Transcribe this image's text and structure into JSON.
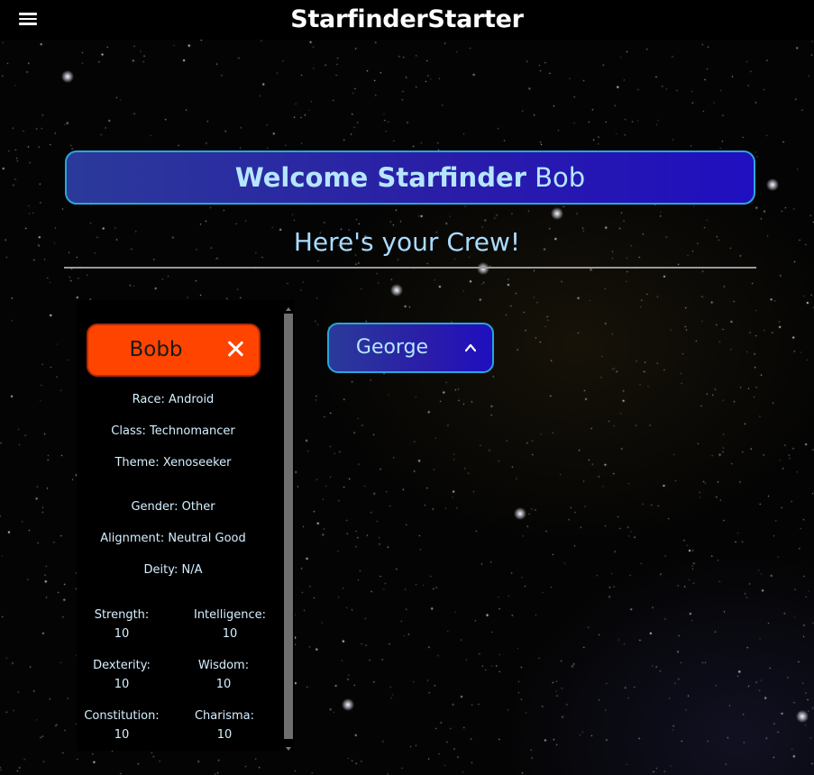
{
  "header": {
    "app_title": "StarfinderStarter",
    "menu_icon": "hamburger-menu-icon"
  },
  "welcome": {
    "prefix": "Welcome Starfinder",
    "user_name": "Bob"
  },
  "crew_heading": "Here's your Crew!",
  "crew": [
    {
      "name": "Bobb",
      "expanded": true,
      "color": "#ff4400",
      "close_icon": "close-icon",
      "details": {
        "race": "Race: Android",
        "class": "Class: Technomancer",
        "theme": "Theme: Xenoseeker",
        "gender": "Gender: Other",
        "alignment": "Alignment: Neutral Good",
        "deity": "Deity: N/A"
      },
      "stats": {
        "strength_label": "Strength:",
        "strength_value": "10",
        "intelligence_label": "Intelligence:",
        "intelligence_value": "10",
        "dexterity_label": "Dexterity:",
        "dexterity_value": "10",
        "wisdom_label": "Wisdom:",
        "wisdom_value": "10",
        "constitution_label": "Constitution:",
        "constitution_value": "10",
        "charisma_label": "Charisma:",
        "charisma_value": "10"
      }
    },
    {
      "name": "George",
      "expanded": false,
      "chevron_icon": "chevron-up-icon"
    }
  ],
  "colors": {
    "accent_border": "#2aa6d8",
    "accent_text": "#b6e6ff",
    "active_card": "#ff4400"
  }
}
